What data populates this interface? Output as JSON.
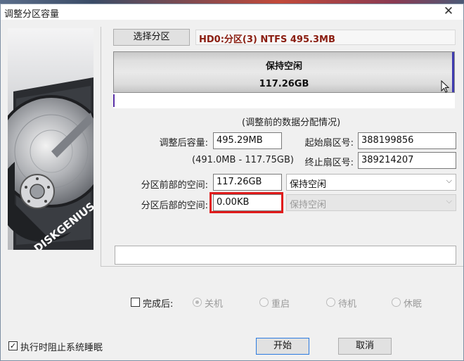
{
  "window": {
    "title": "调整分区容量"
  },
  "actions": {
    "select_partition": "选择分区",
    "start": "开始",
    "cancel": "取消"
  },
  "partition": {
    "info": "HD0:分区(3) NTFS 495.3MB"
  },
  "bar": {
    "label": "保持空闲",
    "size": "117.26GB"
  },
  "section_caption": "(调整前的数据分配情况)",
  "form": {
    "size_after_label": "调整后容量:",
    "size_after_value": "495.29MB",
    "size_range": "(491.0MB - 117.75GB)",
    "start_sector_label": "起始扇区号:",
    "start_sector_value": "388199856",
    "end_sector_label": "终止扇区号:",
    "end_sector_value": "389214207",
    "front_space_label": "分区前部的空间:",
    "front_space_value": "117.26GB",
    "front_space_mode": "保持空闲",
    "rear_space_label": "分区后部的空间:",
    "rear_space_value": "0.00KB",
    "rear_space_mode": "保持空闲"
  },
  "after_completion": {
    "label": "完成后:",
    "options": [
      "关机",
      "重启",
      "待机",
      "休眠"
    ]
  },
  "prevent_sleep": {
    "label": "执行时阻止系统睡眠",
    "checked": true
  },
  "highlight_color": "#e01b1b",
  "icons": {
    "close": "close-icon",
    "dropdown": "chevron-down-icon",
    "cursor": "mouse-cursor-icon"
  },
  "branding": "DISKGENIUS"
}
